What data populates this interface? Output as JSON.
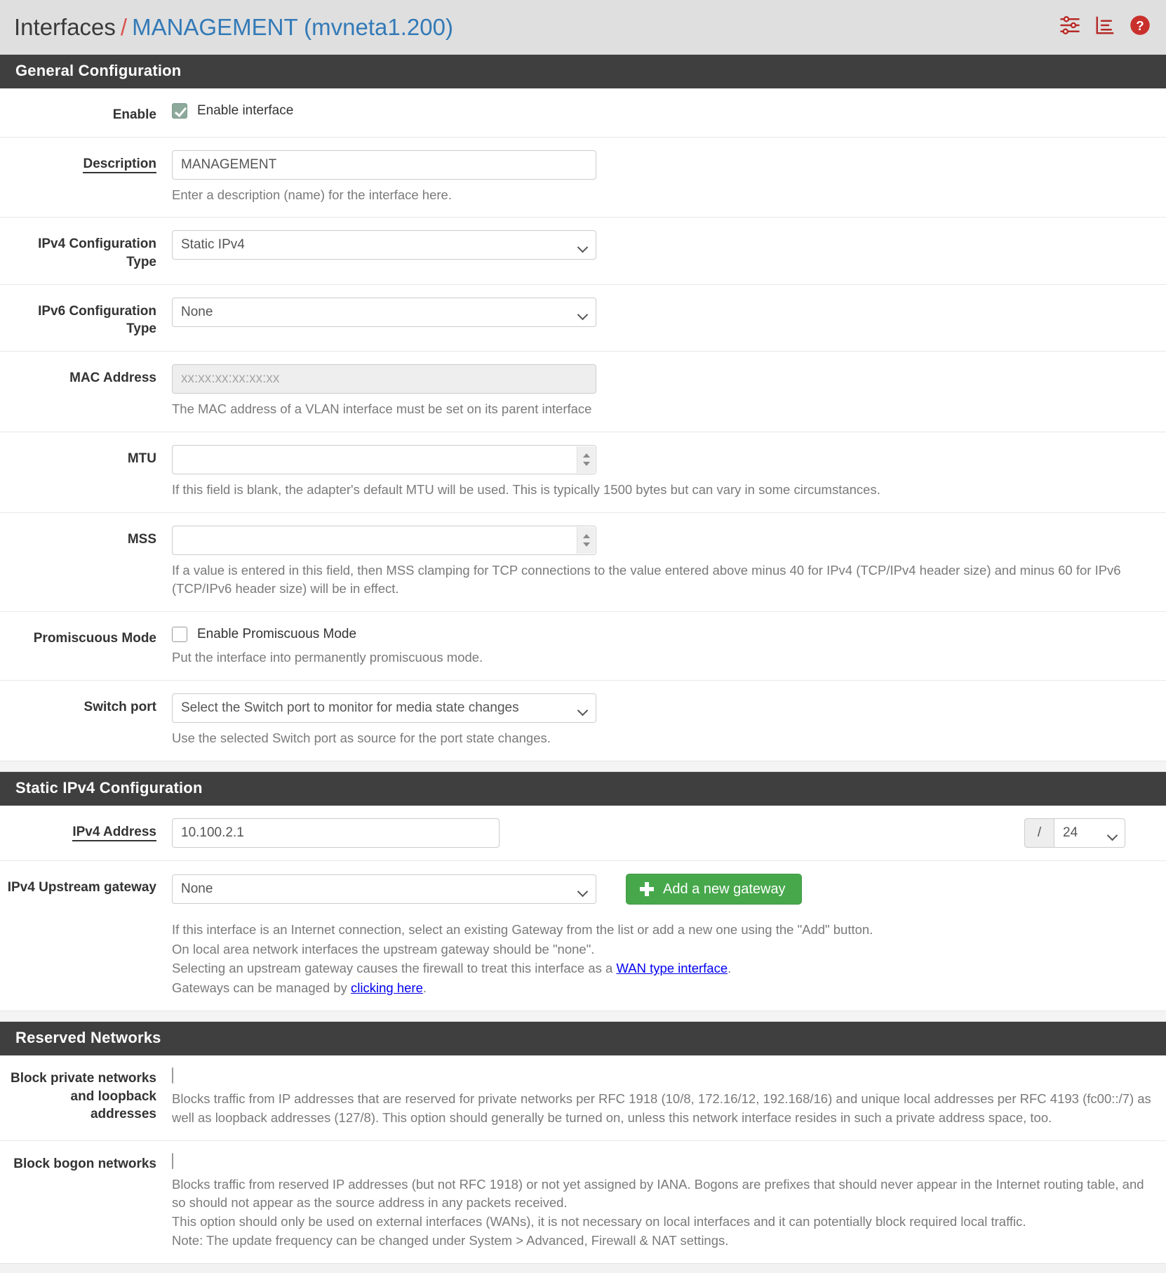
{
  "header": {
    "breadcrumb_root": "Interfaces",
    "breadcrumb_separator": "/",
    "breadcrumb_current": "MANAGEMENT (mvneta1.200)",
    "icons": [
      "sliders-icon",
      "logs-icon",
      "help-icon"
    ]
  },
  "general": {
    "section_title": "General Configuration",
    "enable": {
      "label": "Enable",
      "checkbox_label": "Enable interface",
      "checked": true
    },
    "description": {
      "label": "Description",
      "value": "MANAGEMENT",
      "help": "Enter a description (name) for the interface here."
    },
    "ipv4_config_type": {
      "label": "IPv4 Configuration Type",
      "value": "Static IPv4"
    },
    "ipv6_config_type": {
      "label": "IPv6 Configuration Type",
      "value": "None"
    },
    "mac_address": {
      "label": "MAC Address",
      "placeholder": "xx:xx:xx:xx:xx:xx",
      "value": "",
      "help": "The MAC address of a VLAN interface must be set on its parent interface"
    },
    "mtu": {
      "label": "MTU",
      "value": "",
      "help": "If this field is blank, the adapter's default MTU will be used. This is typically 1500 bytes but can vary in some circumstances."
    },
    "mss": {
      "label": "MSS",
      "value": "",
      "help": "If a value is entered in this field, then MSS clamping for TCP connections to the value entered above minus 40 for IPv4 (TCP/IPv4 header size) and minus 60 for IPv6 (TCP/IPv6 header size) will be in effect."
    },
    "promiscuous": {
      "label": "Promiscuous Mode",
      "checkbox_label": "Enable Promiscuous Mode",
      "checked": false,
      "help": "Put the interface into permanently promiscuous mode."
    },
    "switch_port": {
      "label": "Switch port",
      "value": "Select the Switch port to monitor for media state changes",
      "help": "Use the selected Switch port as source for the port state changes."
    }
  },
  "static_ipv4": {
    "section_title": "Static IPv4 Configuration",
    "address": {
      "label": "IPv4 Address",
      "value": "10.100.2.1",
      "mask_prefix": "/",
      "mask_value": "24"
    },
    "gateway": {
      "label": "IPv4 Upstream gateway",
      "value": "None",
      "add_button": "Add a new gateway",
      "help_line1": "If this interface is an Internet connection, select an existing Gateway from the list or add a new one using the \"Add\" button.",
      "help_line2": "On local area network interfaces the upstream gateway should be \"none\".",
      "help_line3_pre": "Selecting an upstream gateway causes the firewall to treat this interface as a ",
      "help_line3_link": "WAN type interface",
      "help_line3_post": ".",
      "help_line4_pre": "Gateways can be managed by ",
      "help_line4_link": "clicking here",
      "help_line4_post": "."
    }
  },
  "reserved_networks": {
    "section_title": "Reserved Networks",
    "block_private": {
      "label_line1": "Block private networks",
      "label_line2": "and loopback addresses",
      "checked": false,
      "help": "Blocks traffic from IP addresses that are reserved for private networks per RFC 1918 (10/8, 172.16/12, 192.168/16) and unique local addresses per RFC 4193 (fc00::/7) as well as loopback addresses (127/8). This option should generally be turned on, unless this network interface resides in such a private address space, too."
    },
    "block_bogon": {
      "label": "Block bogon networks",
      "checked": false,
      "help_line1": "Blocks traffic from reserved IP addresses (but not RFC 1918) or not yet assigned by IANA. Bogons are prefixes that should never appear in the Internet routing table, and so should not appear as the source address in any packets received.",
      "help_line2": "This option should only be used on external interfaces (WANs), it is not necessary on local interfaces and it can potentially block required local traffic.",
      "help_line3": "Note: The update frequency can be changed under System > Advanced, Firewall & NAT settings."
    }
  },
  "colors": {
    "link": "#337ab7",
    "section_header_bg": "#3f3f3f",
    "accent_red": "#d9534f",
    "button_green": "#46a84b"
  }
}
